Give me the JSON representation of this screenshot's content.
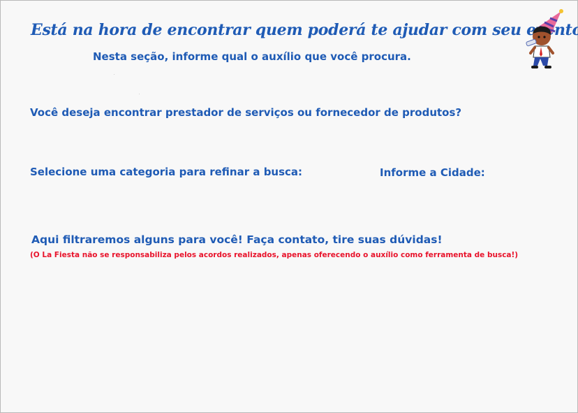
{
  "header": {
    "title": "Está na hora de encontrar quem poderá te ajudar com seu evento!",
    "subtitle": "Nesta seção, informe qual o auxílio que você procura."
  },
  "search": {
    "question": "Você deseja encontrar prestador de serviços ou fornecedor de produtos?",
    "category_label": "Selecione uma categoria para refinar a busca:",
    "city_label": "Informe a Cidade:"
  },
  "results": {
    "heading": "Aqui filtraremos alguns para você! Faça contato, tire suas dúvidas!",
    "disclaimer": "(O La Fiesta não se responsabiliza pelos acordos realizados, apenas oferecendo o auxílio como ferramenta de busca!)"
  },
  "mascot": {
    "icon": "party-boy-mascot-icon"
  },
  "colors": {
    "primary": "#1f5bb5",
    "warning": "#e8132b",
    "background": "#f8f8f8"
  }
}
